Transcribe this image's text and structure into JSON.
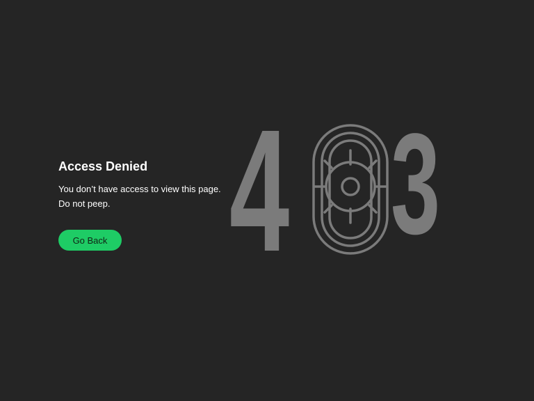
{
  "error": {
    "code_digits": [
      "4",
      "3"
    ],
    "vault_icon": "vault-door-icon",
    "title": "Access Denied",
    "message_lines": [
      "You don’t have access to view this page.",
      "Do not peep."
    ],
    "back_button_label": "Go Back"
  },
  "colors": {
    "background": "#252525",
    "accent": "#1ecc65",
    "illustration": "#7b7b7b",
    "text": "#ffffff"
  }
}
